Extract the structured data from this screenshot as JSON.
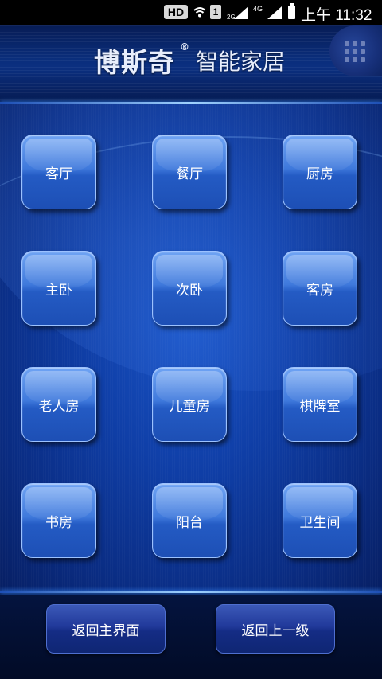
{
  "status_bar": {
    "hd": "HD",
    "sim": "1",
    "net_2g": "2G",
    "net_4g": "4G",
    "time": "上午 11:32"
  },
  "header": {
    "brand": "博斯奇",
    "reg_mark": "®",
    "subtitle": "智能家居",
    "menu_icon": "grid-menu-icon"
  },
  "rooms": [
    {
      "label": "客厅"
    },
    {
      "label": "餐厅"
    },
    {
      "label": "厨房"
    },
    {
      "label": "主卧"
    },
    {
      "label": "次卧"
    },
    {
      "label": "客房"
    },
    {
      "label": "老人房"
    },
    {
      "label": "儿童房"
    },
    {
      "label": "棋牌室"
    },
    {
      "label": "书房"
    },
    {
      "label": "阳台"
    },
    {
      "label": "卫生间"
    }
  ],
  "footer": {
    "home_label": "返回主界面",
    "back_label": "返回上一级"
  },
  "colors": {
    "background": "#0a2c82",
    "button": "#3f79dc",
    "glow": "#9fd2ff"
  }
}
